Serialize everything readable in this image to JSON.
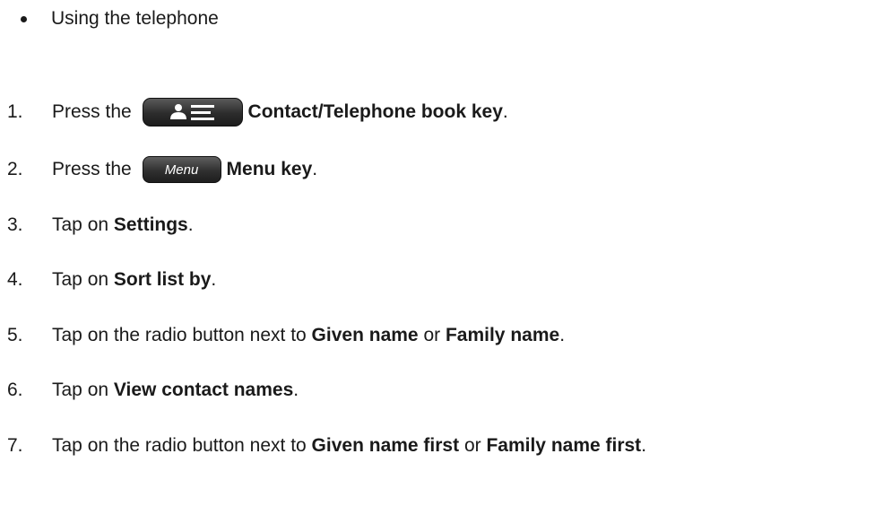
{
  "intro_bullet": "Using the telephone",
  "steps": [
    {
      "num": "1.",
      "pre": "Press the ",
      "bold": "Contact/Telephone book key",
      "post": "."
    },
    {
      "num": "2.",
      "pre": "Press the ",
      "bold": "Menu key",
      "post": ".",
      "key_label": "Menu"
    },
    {
      "num": "3.",
      "pre": "Tap on ",
      "bold": "Settings",
      "post": "."
    },
    {
      "num": "4.",
      "pre": "Tap on ",
      "bold": "Sort list by",
      "post": "."
    },
    {
      "num": "5.",
      "pre": "Tap on the radio button next to ",
      "bold": "Given name",
      "mid": " or ",
      "bold2": "Family name",
      "post": "."
    },
    {
      "num": "6.",
      "pre": "Tap on ",
      "bold": "View contact names",
      "post": "."
    },
    {
      "num": "7.",
      "pre": "Tap on the radio button next to ",
      "bold": "Given name first",
      "mid": " or ",
      "bold2": "Family name first",
      "post": "."
    }
  ],
  "icons": {
    "contact_key": "contact-book-key-icon",
    "menu_key": "menu-key-icon"
  }
}
